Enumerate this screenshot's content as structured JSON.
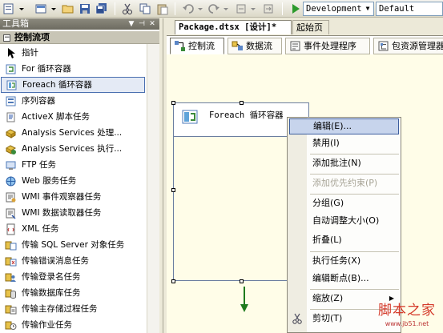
{
  "toolbar": {
    "configuration": "Development",
    "platform": "Default",
    "icons": [
      "new-project-icon",
      "add-item-icon",
      "open-icon",
      "save-icon",
      "save-all-icon",
      "cut-icon",
      "copy-icon",
      "paste-icon",
      "undo-icon",
      "redo-icon",
      "navigate-back-icon",
      "navigate-forward-icon",
      "start-debug-icon"
    ]
  },
  "toolbox": {
    "title": "工具箱",
    "category": "控制流项",
    "items": [
      {
        "label": "指针",
        "icon": "pointer-icon"
      },
      {
        "label": "For 循环容器",
        "icon": "for-loop-icon"
      },
      {
        "label": "Foreach 循环容器",
        "icon": "foreach-loop-icon"
      },
      {
        "label": "序列容器",
        "icon": "sequence-container-icon"
      },
      {
        "label": "ActiveX 脚本任务",
        "icon": "activex-script-icon"
      },
      {
        "label": "Analysis Services 处理...",
        "icon": "analysis-processing-icon"
      },
      {
        "label": "Analysis Services 执行...",
        "icon": "analysis-execute-icon"
      },
      {
        "label": "FTP 任务",
        "icon": "ftp-task-icon"
      },
      {
        "label": "Web 服务任务",
        "icon": "web-service-icon"
      },
      {
        "label": "WMI 事件观察器任务",
        "icon": "wmi-event-icon"
      },
      {
        "label": "WMI 数据读取器任务",
        "icon": "wmi-reader-icon"
      },
      {
        "label": "XML 任务",
        "icon": "xml-task-icon"
      },
      {
        "label": "传输 SQL Server 对象任务",
        "icon": "transfer-objects-icon"
      },
      {
        "label": "传输错误消息任务",
        "icon": "transfer-errors-icon"
      },
      {
        "label": "传输登录名任务",
        "icon": "transfer-logins-icon"
      },
      {
        "label": "传输数据库任务",
        "icon": "transfer-database-icon"
      },
      {
        "label": "传输主存储过程任务",
        "icon": "transfer-procs-icon"
      },
      {
        "label": "传输作业任务",
        "icon": "transfer-jobs-icon"
      }
    ]
  },
  "document": {
    "active_tab": "Package.dtsx [设计]*",
    "other_tab": "起始页",
    "subtabs": [
      "控制流",
      "数据流",
      "事件处理程序",
      "包资源管理器"
    ]
  },
  "designer": {
    "container_title": "Foreach 循环容器"
  },
  "context_menu": {
    "items": [
      {
        "label": "编辑(E)...",
        "state": "hover"
      },
      {
        "label": "禁用(I)",
        "state": "normal"
      },
      {
        "label": "添加批注(N)",
        "state": "normal"
      },
      {
        "label": "添加优先约束(P)",
        "state": "disabled"
      },
      {
        "label": "分组(G)",
        "state": "normal"
      },
      {
        "label": "自动调整大小(O)",
        "state": "normal"
      },
      {
        "label": "折叠(L)",
        "state": "normal"
      },
      {
        "label": "执行任务(X)",
        "state": "normal"
      },
      {
        "label": "编辑断点(B)...",
        "state": "normal"
      },
      {
        "label": "缩放(Z)",
        "state": "normal"
      },
      {
        "label": "剪切(T)",
        "state": "normal"
      }
    ]
  },
  "watermark": {
    "main": "脚本之家",
    "sub": "www.jb51.net"
  },
  "colors": {
    "surface": "#fffde8",
    "menu_highlight": "#c7d4ec",
    "panel_header": "#6d6b60",
    "watermark": "#d43a2a"
  }
}
